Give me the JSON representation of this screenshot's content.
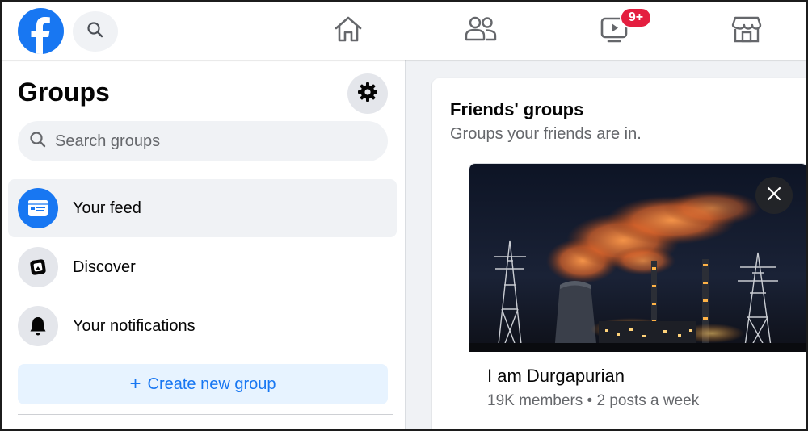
{
  "topbar": {
    "logo_icon": "facebook-logo-icon",
    "search_icon": "search-icon",
    "nav": [
      {
        "name": "home",
        "icon": "home-icon"
      },
      {
        "name": "friends",
        "icon": "friends-icon"
      },
      {
        "name": "watch",
        "icon": "watch-icon",
        "badge": "9+"
      },
      {
        "name": "marketplace",
        "icon": "marketplace-icon"
      }
    ],
    "badge_color": "#e41e3f",
    "brand_color": "#1877f2"
  },
  "sidebar": {
    "title": "Groups",
    "settings_icon": "gear-icon",
    "search_placeholder": "Search groups",
    "items": [
      {
        "label": "Your feed",
        "icon": "feed-icon",
        "active": true
      },
      {
        "label": "Discover",
        "icon": "discover-icon",
        "active": false
      },
      {
        "label": "Your notifications",
        "icon": "bell-icon",
        "active": false
      }
    ],
    "create_label": "Create new group"
  },
  "main": {
    "section_title": "Friends' groups",
    "section_subtitle": "Groups your friends are in.",
    "groups": [
      {
        "name": "I am Durgapurian",
        "meta": "19K members • 2 posts a week",
        "image": "power-plant-night-photo"
      }
    ]
  }
}
